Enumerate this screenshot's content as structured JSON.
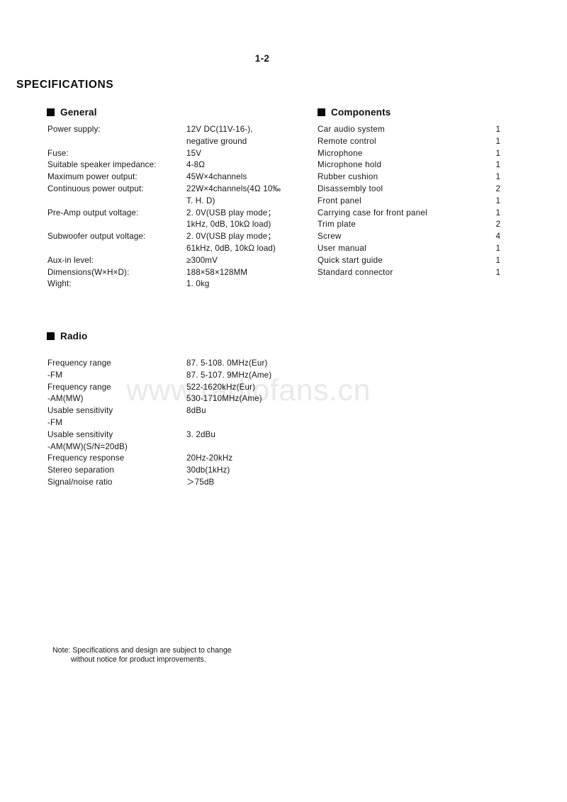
{
  "page": {
    "number": "1-2",
    "title": "SPECIFICATIONS",
    "watermark": "www.radiofans.cn"
  },
  "general": {
    "heading": "General",
    "bullet_icon": "filled-square-bullet",
    "rows": [
      {
        "label": "Power supply:",
        "value": "12V DC(11V-16-),"
      },
      {
        "label": "",
        "value": "negative ground"
      },
      {
        "label": "Fuse:",
        "value": "15V"
      },
      {
        "label": "Suitable speaker impedance:",
        "value": "4-8Ω"
      },
      {
        "label": "Maximum power output:",
        "value": "45W×4channels"
      },
      {
        "label": "Continuous power output:",
        "value": "22W×4channels(4Ω 10‰"
      },
      {
        "label": "",
        "value": "T. H. D)"
      },
      {
        "label": "Pre-Amp output voltage:",
        "value": "2. 0V(USB play mode；"
      },
      {
        "label": "",
        "value": "1kHz, 0dB, 10kΩ load)"
      },
      {
        "label": "Subwoofer output voltage:",
        "value": "2. 0V(USB play mode；"
      },
      {
        "label": "",
        "value": "61kHz, 0dB, 10kΩ load)"
      },
      {
        "label": "Aux-in level:",
        "value": "≥300mV"
      },
      {
        "label": "Dimensions(W×H×D):",
        "value": "188×58×128MM"
      },
      {
        "label": "Wight:",
        "value": "1. 0kg"
      }
    ]
  },
  "components": {
    "heading": "Components",
    "bullet_icon": "filled-square-bullet",
    "rows": [
      {
        "name": "Car audio system",
        "qty": "1"
      },
      {
        "name": "Remote control",
        "qty": "1"
      },
      {
        "name": "Microphone",
        "qty": "1"
      },
      {
        "name": "Microphone hold",
        "qty": "1"
      },
      {
        "name": "Rubber cushion",
        "qty": "1"
      },
      {
        "name": "Disassembly tool",
        "qty": "2"
      },
      {
        "name": "Front panel",
        "qty": "1"
      },
      {
        "name": "Carrying case for front panel",
        "qty": "1"
      },
      {
        "name": "Trim plate",
        "qty": "2"
      },
      {
        "name": "Screw",
        "qty": "4"
      },
      {
        "name": "User manual",
        "qty": "1"
      },
      {
        "name": "Quick start guide",
        "qty": "1"
      },
      {
        "name": "Standard connector",
        "qty": "1"
      }
    ]
  },
  "radio": {
    "heading": "Radio",
    "bullet_icon": "filled-square-bullet",
    "rows": [
      {
        "label": "Frequency range",
        "value": "87. 5-108. 0MHz(Eur)"
      },
      {
        "label": "-FM",
        "value": "87. 5-107. 9MHz(Ame)"
      },
      {
        "label": "Frequency range",
        "value": "522-1620kHz(Eur)"
      },
      {
        "label": "-AM(MW)",
        "value": "530-1710MHz(Ame)"
      },
      {
        "label": "Usable sensitivity",
        "value": "8dBu"
      },
      {
        "label": "-FM",
        "value": ""
      },
      {
        "label": "Usable sensitivity",
        "value": "3. 2dBu"
      },
      {
        "label": "-AM(MW)(S/N=20dB)",
        "value": ""
      },
      {
        "label": "Frequency response",
        "value": "20Hz-20kHz"
      },
      {
        "label": "Stereo separation",
        "value": "30db(1kHz)"
      },
      {
        "label": "Signal/noise ratio",
        "value": "＞75dB"
      }
    ]
  },
  "footer": {
    "note_line_1": "Note: Specifications and design are subject to change",
    "note_line_2": "without notice for product improvements."
  }
}
